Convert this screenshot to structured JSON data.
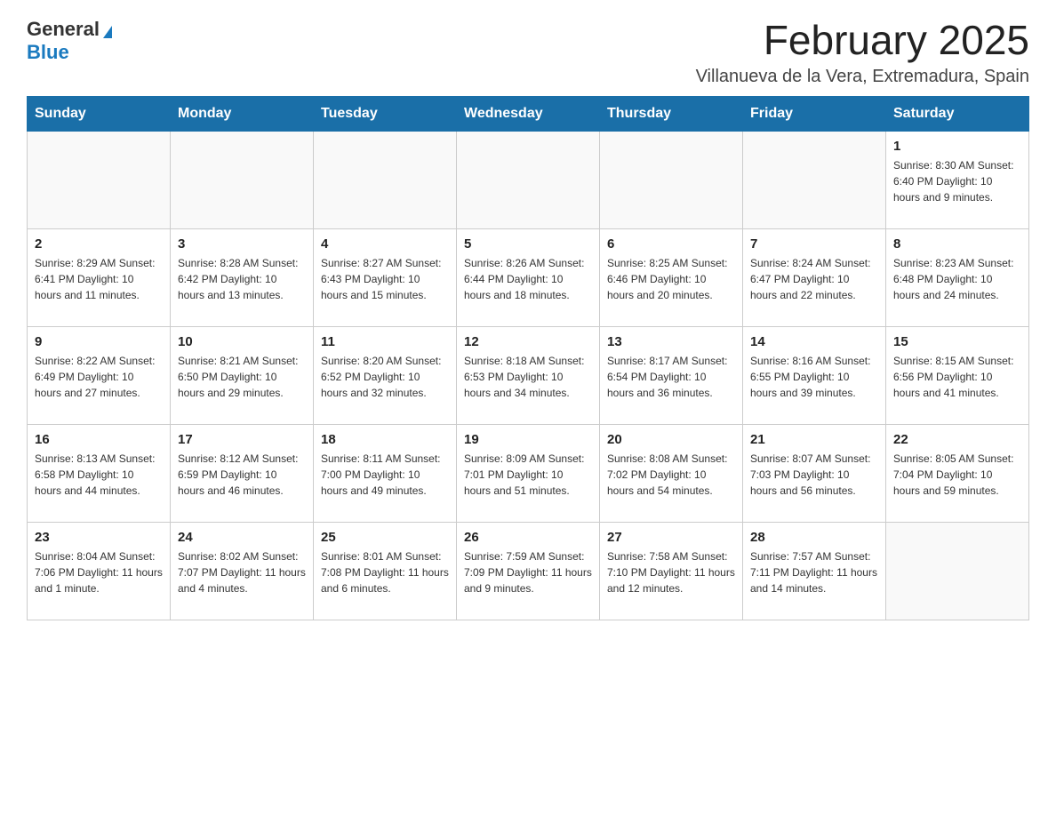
{
  "logo": {
    "general": "General",
    "blue": "Blue"
  },
  "title": "February 2025",
  "location": "Villanueva de la Vera, Extremadura, Spain",
  "days_of_week": [
    "Sunday",
    "Monday",
    "Tuesday",
    "Wednesday",
    "Thursday",
    "Friday",
    "Saturday"
  ],
  "weeks": [
    [
      {
        "day": "",
        "info": ""
      },
      {
        "day": "",
        "info": ""
      },
      {
        "day": "",
        "info": ""
      },
      {
        "day": "",
        "info": ""
      },
      {
        "day": "",
        "info": ""
      },
      {
        "day": "",
        "info": ""
      },
      {
        "day": "1",
        "info": "Sunrise: 8:30 AM\nSunset: 6:40 PM\nDaylight: 10 hours and 9 minutes."
      }
    ],
    [
      {
        "day": "2",
        "info": "Sunrise: 8:29 AM\nSunset: 6:41 PM\nDaylight: 10 hours and 11 minutes."
      },
      {
        "day": "3",
        "info": "Sunrise: 8:28 AM\nSunset: 6:42 PM\nDaylight: 10 hours and 13 minutes."
      },
      {
        "day": "4",
        "info": "Sunrise: 8:27 AM\nSunset: 6:43 PM\nDaylight: 10 hours and 15 minutes."
      },
      {
        "day": "5",
        "info": "Sunrise: 8:26 AM\nSunset: 6:44 PM\nDaylight: 10 hours and 18 minutes."
      },
      {
        "day": "6",
        "info": "Sunrise: 8:25 AM\nSunset: 6:46 PM\nDaylight: 10 hours and 20 minutes."
      },
      {
        "day": "7",
        "info": "Sunrise: 8:24 AM\nSunset: 6:47 PM\nDaylight: 10 hours and 22 minutes."
      },
      {
        "day": "8",
        "info": "Sunrise: 8:23 AM\nSunset: 6:48 PM\nDaylight: 10 hours and 24 minutes."
      }
    ],
    [
      {
        "day": "9",
        "info": "Sunrise: 8:22 AM\nSunset: 6:49 PM\nDaylight: 10 hours and 27 minutes."
      },
      {
        "day": "10",
        "info": "Sunrise: 8:21 AM\nSunset: 6:50 PM\nDaylight: 10 hours and 29 minutes."
      },
      {
        "day": "11",
        "info": "Sunrise: 8:20 AM\nSunset: 6:52 PM\nDaylight: 10 hours and 32 minutes."
      },
      {
        "day": "12",
        "info": "Sunrise: 8:18 AM\nSunset: 6:53 PM\nDaylight: 10 hours and 34 minutes."
      },
      {
        "day": "13",
        "info": "Sunrise: 8:17 AM\nSunset: 6:54 PM\nDaylight: 10 hours and 36 minutes."
      },
      {
        "day": "14",
        "info": "Sunrise: 8:16 AM\nSunset: 6:55 PM\nDaylight: 10 hours and 39 minutes."
      },
      {
        "day": "15",
        "info": "Sunrise: 8:15 AM\nSunset: 6:56 PM\nDaylight: 10 hours and 41 minutes."
      }
    ],
    [
      {
        "day": "16",
        "info": "Sunrise: 8:13 AM\nSunset: 6:58 PM\nDaylight: 10 hours and 44 minutes."
      },
      {
        "day": "17",
        "info": "Sunrise: 8:12 AM\nSunset: 6:59 PM\nDaylight: 10 hours and 46 minutes."
      },
      {
        "day": "18",
        "info": "Sunrise: 8:11 AM\nSunset: 7:00 PM\nDaylight: 10 hours and 49 minutes."
      },
      {
        "day": "19",
        "info": "Sunrise: 8:09 AM\nSunset: 7:01 PM\nDaylight: 10 hours and 51 minutes."
      },
      {
        "day": "20",
        "info": "Sunrise: 8:08 AM\nSunset: 7:02 PM\nDaylight: 10 hours and 54 minutes."
      },
      {
        "day": "21",
        "info": "Sunrise: 8:07 AM\nSunset: 7:03 PM\nDaylight: 10 hours and 56 minutes."
      },
      {
        "day": "22",
        "info": "Sunrise: 8:05 AM\nSunset: 7:04 PM\nDaylight: 10 hours and 59 minutes."
      }
    ],
    [
      {
        "day": "23",
        "info": "Sunrise: 8:04 AM\nSunset: 7:06 PM\nDaylight: 11 hours and 1 minute."
      },
      {
        "day": "24",
        "info": "Sunrise: 8:02 AM\nSunset: 7:07 PM\nDaylight: 11 hours and 4 minutes."
      },
      {
        "day": "25",
        "info": "Sunrise: 8:01 AM\nSunset: 7:08 PM\nDaylight: 11 hours and 6 minutes."
      },
      {
        "day": "26",
        "info": "Sunrise: 7:59 AM\nSunset: 7:09 PM\nDaylight: 11 hours and 9 minutes."
      },
      {
        "day": "27",
        "info": "Sunrise: 7:58 AM\nSunset: 7:10 PM\nDaylight: 11 hours and 12 minutes."
      },
      {
        "day": "28",
        "info": "Sunrise: 7:57 AM\nSunset: 7:11 PM\nDaylight: 11 hours and 14 minutes."
      },
      {
        "day": "",
        "info": ""
      }
    ]
  ]
}
